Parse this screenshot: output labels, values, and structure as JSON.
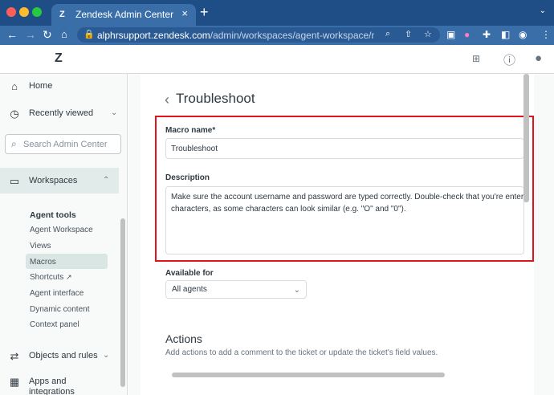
{
  "browser": {
    "tab_title": "Zendesk Admin Center",
    "tab_icon": "zendesk-logo-icon",
    "url_host": "alphrsupport.zendesk.com",
    "url_path": "/admin/workspaces/agent-workspace/macr...",
    "window_colors": {
      "close": "#ff5f57",
      "minimize": "#febc2e",
      "maximize": "#28c840",
      "chrome": "#3a6ea8"
    }
  },
  "sidebar": {
    "home": "Home",
    "recently_viewed": "Recently viewed",
    "search_placeholder": "Search Admin Center",
    "workspaces": "Workspaces",
    "agent_tools": "Agent tools",
    "sub_items": [
      "Agent Workspace",
      "Views",
      "Macros",
      "Shortcuts",
      "Agent interface",
      "Dynamic content",
      "Context panel"
    ],
    "selected_item": "Macros",
    "objects_and_rules": "Objects and rules",
    "apps_line1": "Apps and",
    "apps_line2": "integrations"
  },
  "main": {
    "page_title": "Troubleshoot",
    "macro_name_label": "Macro name*",
    "macro_name_value": "Troubleshoot",
    "description_label": "Description",
    "description_line1": "Make sure the account username and password are typed correctly. Double-check that you're entering",
    "description_line2": "characters, as some characters can look similar (e.g. \"O\" and \"0\").",
    "available_for_label": "Available for",
    "available_for_value": "All agents",
    "actions_heading": "Actions",
    "actions_desc": "Add actions to add a comment to the ticket or update the ticket's field values.",
    "highlight_color": "#e3131b"
  }
}
